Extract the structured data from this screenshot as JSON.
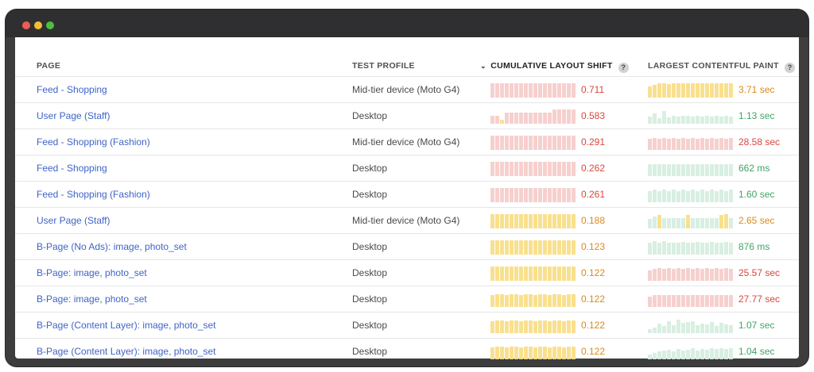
{
  "colors": {
    "red_text": "#d9473b",
    "orange_text": "#d98a1f",
    "green_text": "#3fa463",
    "red_bar": "#f6d0ce",
    "yellow_bar": "#f9e08e",
    "green_bar": "#d8efe2",
    "link": "#3e64c6"
  },
  "header": {
    "page": "PAGE",
    "test_profile": "TEST PROFILE",
    "cls": "CUMULATIVE LAYOUT SHIFT",
    "lcp": "LARGEST CONTENTFUL PAINT",
    "sort_icon": "chevron-down-icon",
    "help_icon": "question-circle-icon"
  },
  "rows": [
    {
      "page": "Feed - Shopping",
      "profile": "Mid-tier device (Moto G4)",
      "cls": {
        "value": "0.711",
        "status": "red",
        "bars": [
          1,
          1,
          1,
          1,
          1,
          1,
          1,
          1,
          1,
          1,
          1,
          1,
          1,
          1,
          1,
          1,
          1,
          1
        ],
        "bar_status": [
          "red",
          "red",
          "red",
          "red",
          "red",
          "red",
          "red",
          "red",
          "red",
          "red",
          "red",
          "red",
          "red",
          "red",
          "red",
          "red",
          "red",
          "red"
        ]
      },
      "lcp": {
        "value": "3.71 sec",
        "status": "orange",
        "bars": [
          0.8,
          0.9,
          1,
          1,
          0.95,
          1,
          1,
          1,
          1,
          1,
          1,
          1,
          1,
          1,
          1,
          1,
          1,
          1
        ],
        "bar_status": [
          "yellow",
          "yellow",
          "yellow",
          "yellow",
          "yellow",
          "yellow",
          "yellow",
          "yellow",
          "yellow",
          "yellow",
          "yellow",
          "yellow",
          "yellow",
          "yellow",
          "yellow",
          "yellow",
          "yellow",
          "yellow"
        ]
      }
    },
    {
      "page": "User Page (Staff)",
      "profile": "Desktop",
      "cls": {
        "value": "0.583",
        "status": "red",
        "bars": [
          0.55,
          0.55,
          0.3,
          0.75,
          0.75,
          0.75,
          0.75,
          0.75,
          0.75,
          0.75,
          0.75,
          0.75,
          0.8,
          1,
          1,
          1,
          1,
          1
        ],
        "bar_status": [
          "red",
          "red",
          "yellow",
          "red",
          "red",
          "red",
          "red",
          "red",
          "red",
          "red",
          "red",
          "red",
          "red",
          "red",
          "red",
          "red",
          "red",
          "red"
        ]
      },
      "lcp": {
        "value": "1.13 sec",
        "status": "green",
        "bars": [
          0.5,
          0.7,
          0.4,
          0.9,
          0.45,
          0.55,
          0.5,
          0.55,
          0.55,
          0.5,
          0.55,
          0.5,
          0.55,
          0.5,
          0.55,
          0.5,
          0.55,
          0.5
        ],
        "bar_status": [
          "green",
          "green",
          "green",
          "green",
          "green",
          "green",
          "green",
          "green",
          "green",
          "green",
          "green",
          "green",
          "green",
          "green",
          "green",
          "green",
          "green",
          "green"
        ]
      }
    },
    {
      "page": "Feed - Shopping (Fashion)",
      "profile": "Mid-tier device (Moto G4)",
      "cls": {
        "value": "0.291",
        "status": "red",
        "bars": [
          1,
          1,
          1,
          1,
          1,
          1,
          1,
          1,
          1,
          1,
          1,
          1,
          1,
          1,
          1,
          1,
          1,
          1
        ],
        "bar_status": [
          "red",
          "red",
          "red",
          "red",
          "red",
          "red",
          "red",
          "red",
          "red",
          "red",
          "red",
          "red",
          "red",
          "red",
          "red",
          "red",
          "red",
          "red"
        ]
      },
      "lcp": {
        "value": "28.58 sec",
        "status": "red",
        "bars": [
          0.75,
          0.85,
          0.75,
          0.85,
          0.75,
          0.85,
          0.75,
          0.85,
          0.75,
          0.85,
          0.75,
          0.85,
          0.75,
          0.85,
          0.75,
          0.85,
          0.75,
          0.85
        ],
        "bar_status": [
          "red",
          "red",
          "red",
          "red",
          "red",
          "red",
          "red",
          "red",
          "red",
          "red",
          "red",
          "red",
          "red",
          "red",
          "red",
          "red",
          "red",
          "red"
        ]
      }
    },
    {
      "page": "Feed - Shopping",
      "profile": "Desktop",
      "cls": {
        "value": "0.262",
        "status": "red",
        "bars": [
          1,
          1,
          1,
          1,
          1,
          1,
          1,
          1,
          1,
          1,
          1,
          1,
          1,
          1,
          1,
          1,
          1,
          1
        ],
        "bar_status": [
          "red",
          "red",
          "red",
          "red",
          "red",
          "red",
          "red",
          "red",
          "red",
          "red",
          "red",
          "red",
          "red",
          "red",
          "red",
          "red",
          "red",
          "red"
        ]
      },
      "lcp": {
        "value": "662 ms",
        "status": "green",
        "bars": [
          0.85,
          0.85,
          0.85,
          0.85,
          0.85,
          0.85,
          0.85,
          0.85,
          0.85,
          0.85,
          0.85,
          0.85,
          0.85,
          0.85,
          0.85,
          0.85,
          0.85,
          0.85
        ],
        "bar_status": [
          "green",
          "green",
          "green",
          "green",
          "green",
          "green",
          "green",
          "green",
          "green",
          "green",
          "green",
          "green",
          "green",
          "green",
          "green",
          "green",
          "green",
          "green"
        ]
      }
    },
    {
      "page": "Feed - Shopping (Fashion)",
      "profile": "Desktop",
      "cls": {
        "value": "0.261",
        "status": "red",
        "bars": [
          1,
          1,
          1,
          1,
          1,
          1,
          1,
          1,
          1,
          1,
          1,
          1,
          1,
          1,
          1,
          1,
          1,
          1
        ],
        "bar_status": [
          "red",
          "red",
          "red",
          "red",
          "red",
          "red",
          "red",
          "red",
          "red",
          "red",
          "red",
          "red",
          "red",
          "red",
          "red",
          "red",
          "red",
          "red"
        ]
      },
      "lcp": {
        "value": "1.60 sec",
        "status": "green",
        "bars": [
          0.8,
          0.9,
          0.8,
          0.9,
          0.8,
          0.9,
          0.8,
          0.9,
          0.8,
          0.9,
          0.8,
          0.9,
          0.8,
          0.9,
          0.8,
          0.9,
          0.8,
          0.9
        ],
        "bar_status": [
          "green",
          "green",
          "green",
          "green",
          "green",
          "green",
          "green",
          "green",
          "green",
          "green",
          "green",
          "green",
          "green",
          "green",
          "green",
          "green",
          "green",
          "green"
        ]
      }
    },
    {
      "page": "User Page (Staff)",
      "profile": "Mid-tier device (Moto G4)",
      "cls": {
        "value": "0.188",
        "status": "orange",
        "bars": [
          1,
          1,
          1,
          1,
          1,
          1,
          1,
          1,
          1,
          1,
          1,
          1,
          1,
          1,
          1,
          1,
          1,
          1
        ],
        "bar_status": [
          "yellow",
          "yellow",
          "yellow",
          "yellow",
          "yellow",
          "yellow",
          "yellow",
          "yellow",
          "yellow",
          "yellow",
          "yellow",
          "yellow",
          "yellow",
          "yellow",
          "yellow",
          "yellow",
          "yellow",
          "yellow"
        ]
      },
      "lcp": {
        "value": "2.65 sec",
        "status": "orange",
        "bars": [
          0.65,
          0.85,
          0.95,
          0.7,
          0.7,
          0.7,
          0.7,
          0.7,
          0.95,
          0.7,
          0.7,
          0.7,
          0.7,
          0.7,
          0.7,
          0.95,
          1,
          0.7
        ],
        "bar_status": [
          "green",
          "green",
          "yellow",
          "green",
          "green",
          "green",
          "green",
          "green",
          "yellow",
          "green",
          "green",
          "green",
          "green",
          "green",
          "green",
          "yellow",
          "yellow",
          "green"
        ]
      }
    },
    {
      "page": "B-Page (No Ads): image, photo_set",
      "profile": "Desktop",
      "cls": {
        "value": "0.123",
        "status": "orange",
        "bars": [
          1,
          1,
          1,
          1,
          1,
          1,
          1,
          1,
          1,
          1,
          1,
          1,
          1,
          1,
          1,
          1,
          1,
          1
        ],
        "bar_status": [
          "yellow",
          "yellow",
          "yellow",
          "yellow",
          "yellow",
          "yellow",
          "yellow",
          "yellow",
          "yellow",
          "yellow",
          "yellow",
          "yellow",
          "yellow",
          "yellow",
          "yellow",
          "yellow",
          "yellow",
          "yellow"
        ]
      },
      "lcp": {
        "value": "876 ms",
        "status": "green",
        "bars": [
          0.85,
          0.95,
          0.85,
          0.95,
          0.85,
          0.85,
          0.85,
          0.9,
          0.85,
          0.85,
          0.9,
          0.85,
          0.85,
          0.9,
          0.85,
          0.85,
          0.9,
          0.85
        ],
        "bar_status": [
          "green",
          "green",
          "green",
          "green",
          "green",
          "green",
          "green",
          "green",
          "green",
          "green",
          "green",
          "green",
          "green",
          "green",
          "green",
          "green",
          "green",
          "green"
        ]
      }
    },
    {
      "page": "B-Page: image, photo_set",
      "profile": "Desktop",
      "cls": {
        "value": "0.122",
        "status": "orange",
        "bars": [
          1,
          1,
          1,
          1,
          1,
          1,
          1,
          1,
          1,
          1,
          1,
          1,
          1,
          1,
          1,
          1,
          1,
          1
        ],
        "bar_status": [
          "yellow",
          "yellow",
          "yellow",
          "yellow",
          "yellow",
          "yellow",
          "yellow",
          "yellow",
          "yellow",
          "yellow",
          "yellow",
          "yellow",
          "yellow",
          "yellow",
          "yellow",
          "yellow",
          "yellow",
          "yellow"
        ]
      },
      "lcp": {
        "value": "25.57 sec",
        "status": "red",
        "bars": [
          0.7,
          0.85,
          0.9,
          0.85,
          0.9,
          0.85,
          0.9,
          0.85,
          0.9,
          0.85,
          0.9,
          0.85,
          0.9,
          0.85,
          0.9,
          0.85,
          0.9,
          0.85
        ],
        "bar_status": [
          "red",
          "red",
          "red",
          "red",
          "red",
          "red",
          "red",
          "red",
          "red",
          "red",
          "red",
          "red",
          "red",
          "red",
          "red",
          "red",
          "red",
          "red"
        ]
      }
    },
    {
      "page": "B-Page: image, photo_set",
      "profile": "Desktop",
      "cls": {
        "value": "0.122",
        "status": "orange",
        "bars": [
          0.85,
          0.9,
          0.9,
          0.85,
          0.9,
          0.9,
          0.85,
          0.9,
          0.9,
          0.85,
          0.9,
          0.9,
          0.85,
          0.9,
          0.9,
          0.85,
          0.9,
          0.9
        ],
        "bar_status": [
          "yellow",
          "yellow",
          "yellow",
          "yellow",
          "yellow",
          "yellow",
          "yellow",
          "yellow",
          "yellow",
          "yellow",
          "yellow",
          "yellow",
          "yellow",
          "yellow",
          "yellow",
          "yellow",
          "yellow",
          "yellow"
        ]
      },
      "lcp": {
        "value": "27.77 sec",
        "status": "red",
        "bars": [
          0.7,
          0.85,
          0.85,
          0.85,
          0.85,
          0.85,
          0.85,
          0.85,
          0.85,
          0.85,
          0.85,
          0.85,
          0.85,
          0.85,
          0.85,
          0.85,
          0.85,
          0.85
        ],
        "bar_status": [
          "red",
          "red",
          "red",
          "red",
          "red",
          "red",
          "red",
          "red",
          "red",
          "red",
          "red",
          "red",
          "red",
          "red",
          "red",
          "red",
          "red",
          "red"
        ]
      }
    },
    {
      "page": "B-Page (Content Layer): image, photo_set",
      "profile": "Desktop",
      "cls": {
        "value": "0.122",
        "status": "orange",
        "bars": [
          0.85,
          0.9,
          0.9,
          0.85,
          0.9,
          0.9,
          0.85,
          0.9,
          0.9,
          0.85,
          0.9,
          0.9,
          0.85,
          0.9,
          0.9,
          0.85,
          0.9,
          0.9
        ],
        "bar_status": [
          "yellow",
          "yellow",
          "yellow",
          "yellow",
          "yellow",
          "yellow",
          "yellow",
          "yellow",
          "yellow",
          "yellow",
          "yellow",
          "yellow",
          "yellow",
          "yellow",
          "yellow",
          "yellow",
          "yellow",
          "yellow"
        ]
      },
      "lcp": {
        "value": "1.07 sec",
        "status": "green",
        "bars": [
          0.3,
          0.4,
          0.65,
          0.5,
          0.85,
          0.55,
          0.95,
          0.7,
          0.8,
          0.85,
          0.55,
          0.65,
          0.6,
          0.75,
          0.5,
          0.7,
          0.6,
          0.55
        ],
        "bar_status": [
          "green",
          "green",
          "green",
          "green",
          "green",
          "green",
          "green",
          "green",
          "green",
          "green",
          "green",
          "green",
          "green",
          "green",
          "green",
          "green",
          "green",
          "green"
        ]
      }
    },
    {
      "page": "B-Page (Content Layer): image, photo_set",
      "profile": "Desktop",
      "cls": {
        "value": "0.122",
        "status": "orange",
        "bars": [
          0.85,
          0.9,
          0.9,
          0.85,
          0.9,
          0.9,
          0.85,
          0.9,
          0.9,
          0.85,
          0.9,
          0.9,
          0.85,
          0.9,
          0.9,
          0.85,
          0.9,
          0.9
        ],
        "bar_status": [
          "yellow",
          "yellow",
          "yellow",
          "yellow",
          "yellow",
          "yellow",
          "yellow",
          "yellow",
          "yellow",
          "yellow",
          "yellow",
          "yellow",
          "yellow",
          "yellow",
          "yellow",
          "yellow",
          "yellow",
          "yellow"
        ]
      },
      "lcp": {
        "value": "1.04 sec",
        "status": "green",
        "bars": [
          0.35,
          0.45,
          0.55,
          0.6,
          0.65,
          0.55,
          0.7,
          0.6,
          0.65,
          0.75,
          0.6,
          0.7,
          0.65,
          0.75,
          0.7,
          0.8,
          0.7,
          0.75
        ],
        "bar_status": [
          "green",
          "green",
          "green",
          "green",
          "green",
          "green",
          "green",
          "green",
          "green",
          "green",
          "green",
          "green",
          "green",
          "green",
          "green",
          "green",
          "green",
          "green"
        ]
      }
    }
  ]
}
